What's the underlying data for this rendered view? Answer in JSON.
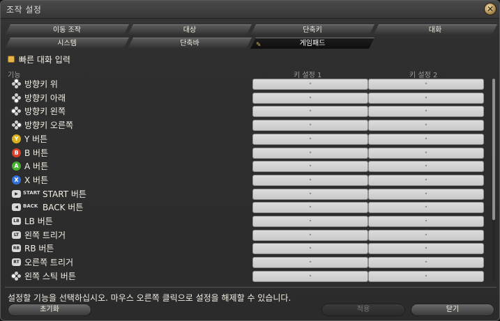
{
  "window": {
    "title": "조작 설정"
  },
  "tabs_row1": [
    {
      "label": "이동 조작",
      "active": false
    },
    {
      "label": "대상",
      "active": false
    },
    {
      "label": "단축키",
      "active": false
    },
    {
      "label": "대화",
      "active": false
    }
  ],
  "tabs_row2": [
    {
      "label": "시스템",
      "active": false
    },
    {
      "label": "단축바",
      "active": false
    },
    {
      "label": "게임패드",
      "active": true
    }
  ],
  "options": {
    "quick_chat_label": "빠른 대화 입력",
    "quick_chat_checked": true
  },
  "columns": {
    "function": "기능",
    "key1": "키 설정 1",
    "key2": "키 설정 2"
  },
  "rows": [
    {
      "icon": "dpad-up-icon",
      "tag": "",
      "label": "방향키 위",
      "key1": "•",
      "key2": "•"
    },
    {
      "icon": "dpad-down-icon",
      "tag": "",
      "label": "방향키 아래",
      "key1": "•",
      "key2": "•"
    },
    {
      "icon": "dpad-left-icon",
      "tag": "",
      "label": "방향키 왼쪽",
      "key1": "•",
      "key2": "•"
    },
    {
      "icon": "dpad-right-icon",
      "tag": "",
      "label": "방향키 오른쪽",
      "key1": "•",
      "key2": "•"
    },
    {
      "icon": "y-button-icon",
      "tag": "",
      "label": "Y 버튼",
      "key1": "•",
      "key2": "•"
    },
    {
      "icon": "b-button-icon",
      "tag": "",
      "label": "B 버튼",
      "key1": "•",
      "key2": "•"
    },
    {
      "icon": "a-button-icon",
      "tag": "",
      "label": "A 버튼",
      "key1": "•",
      "key2": "•"
    },
    {
      "icon": "x-button-icon",
      "tag": "",
      "label": "X 버튼",
      "key1": "•",
      "key2": "•"
    },
    {
      "icon": "start-button-icon",
      "tag": "START",
      "label": "START 버튼",
      "key1": "•",
      "key2": "•"
    },
    {
      "icon": "back-button-icon",
      "tag": "BACK",
      "label": "BACK 버튼",
      "key1": "•",
      "key2": "•"
    },
    {
      "icon": "lb-button-icon",
      "tag": "LB",
      "label": "LB 버튼",
      "key1": "•",
      "key2": "•"
    },
    {
      "icon": "lt-trigger-icon",
      "tag": "LT",
      "label": "왼쪽 트리거",
      "key1": "•",
      "key2": "•"
    },
    {
      "icon": "rb-button-icon",
      "tag": "RB",
      "label": "RB 버튼",
      "key1": "•",
      "key2": "•"
    },
    {
      "icon": "rt-trigger-icon",
      "tag": "RT",
      "label": "오른쪽 트리거",
      "key1": "•",
      "key2": "•"
    },
    {
      "icon": "left-stick-icon",
      "tag": "",
      "label": "왼쪽 스틱 버튼",
      "key1": "•",
      "key2": "•"
    }
  ],
  "status_text": "설정할 기능을 선택하십시오. 마우스 오른쪽 클릭으로 설정을 해제할 수 있습니다.",
  "buttons": {
    "reset": "초기화",
    "apply": "적용",
    "close": "닫기"
  },
  "colors": {
    "y": "#d8b020",
    "b": "#d8402a",
    "a": "#48b030",
    "x": "#3070d8",
    "accent": "#e6b54a"
  },
  "scroll": {
    "visible_fraction": 0.7
  }
}
